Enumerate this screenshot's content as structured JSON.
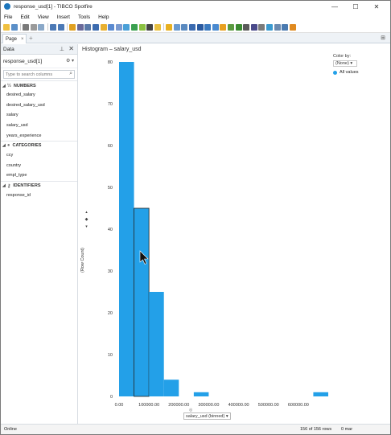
{
  "window": {
    "title": "response_usd[1] - TIBCO Spotfire",
    "controls": {
      "minimize": "—",
      "maximize": "☐",
      "close": "✕"
    }
  },
  "menu": [
    "File",
    "Edit",
    "View",
    "Insert",
    "Tools",
    "Help"
  ],
  "tabs": {
    "page_label": "Page",
    "close": "×",
    "add": "+",
    "menu": "⊞"
  },
  "data_panel": {
    "title": "Data",
    "table_name": "response_usd[1]",
    "search_placeholder": "Type to search columns",
    "groups": [
      {
        "label": "NUMBERS",
        "columns": [
          "desired_salary",
          "desired_salary_usd",
          "salary",
          "salary_usd",
          "years_experience"
        ]
      },
      {
        "label": "CATEGORIES",
        "columns": [
          "ccy",
          "country",
          "empl_type"
        ]
      },
      {
        "label": "IDENTIFIERS",
        "columns": [
          "response_id"
        ]
      }
    ]
  },
  "viz": {
    "title": "Histogram – salary_usd",
    "color_by_label": "Color by:",
    "color_by_value": "(None)",
    "legend_item": "All values",
    "y_axis_label": "(Row Count)",
    "x_axis_selector": "salary_usd (binned)",
    "accent_color": "#23a0e8"
  },
  "chart_data": {
    "type": "bar",
    "title": "Histogram – salary_usd",
    "xlabel": "salary_usd (binned)",
    "ylabel": "(Row Count)",
    "xlim": [
      0,
      700000
    ],
    "ylim": [
      0,
      80
    ],
    "x_ticks": [
      "0.00",
      "100000.00",
      "200000.00",
      "300000.00",
      "400000.00",
      "500000.00",
      "600000.00"
    ],
    "y_ticks": [
      "0",
      "10",
      "20",
      "30",
      "40",
      "50",
      "60",
      "70",
      "80"
    ],
    "bin_width": 50000,
    "bins": [
      {
        "start": 0,
        "value": 80
      },
      {
        "start": 50000,
        "value": 45
      },
      {
        "start": 100000,
        "value": 25
      },
      {
        "start": 150000,
        "value": 4
      },
      {
        "start": 200000,
        "value": 0
      },
      {
        "start": 250000,
        "value": 1
      },
      {
        "start": 300000,
        "value": 0
      },
      {
        "start": 350000,
        "value": 0
      },
      {
        "start": 400000,
        "value": 0
      },
      {
        "start": 450000,
        "value": 0
      },
      {
        "start": 500000,
        "value": 0
      },
      {
        "start": 550000,
        "value": 0
      },
      {
        "start": 600000,
        "value": 0
      },
      {
        "start": 650000,
        "value": 1
      }
    ],
    "legend": "top-right",
    "grid": false
  },
  "status": {
    "state": "Online",
    "rows": "156 of 156 rows",
    "marked": "0 mar"
  }
}
